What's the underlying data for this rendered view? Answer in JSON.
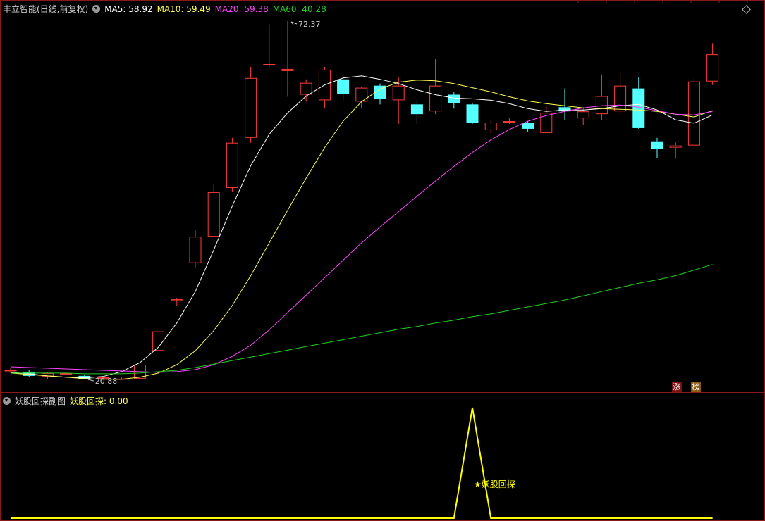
{
  "header": {
    "title": "丰立智能(日线,前复权)",
    "ma5_label": "MA5: 58.92",
    "ma10_label": "MA10: 59.49",
    "ma20_label": "MA20: 59.38",
    "ma60_label": "MA60: 40.28"
  },
  "sub_header": {
    "title": "妖股回探副图",
    "value_label": "妖股回探: 0.00"
  },
  "badges": {
    "zhang": "涨",
    "bang": "榜"
  },
  "colors": {
    "up": "#ff3b3b",
    "down": "#54ffff",
    "ma5": "#ffffff",
    "ma10": "#ffff54",
    "ma20": "#ff44ff",
    "ma60": "#22d022",
    "signal": "#ffff00"
  },
  "chart_data": [
    {
      "type": "candlestick",
      "title": "丰立智能(日线,前复权)",
      "price_range": [
        20.88,
        72.37
      ],
      "annotations": {
        "high": "72.37",
        "low": "20.88"
      },
      "candles": [
        {
          "o": 22.2,
          "c": 22.2,
          "h": 22.6,
          "l": 21.8
        },
        {
          "o": 22.0,
          "c": 21.4,
          "h": 22.2,
          "l": 21.2
        },
        {
          "o": 21.3,
          "c": 21.8,
          "h": 22.0,
          "l": 21.0
        },
        {
          "o": 21.6,
          "c": 21.8,
          "h": 21.9,
          "l": 21.5
        },
        {
          "o": 21.4,
          "c": 20.9,
          "h": 21.6,
          "l": 20.88
        },
        {
          "o": 21.0,
          "c": 21.2,
          "h": 21.3,
          "l": 20.9
        },
        {
          "o": 21.0,
          "c": 21.0,
          "h": 21.2,
          "l": 20.9
        },
        {
          "o": 21.0,
          "c": 23.0,
          "h": 23.2,
          "l": 20.9
        },
        {
          "o": 25.0,
          "c": 27.8,
          "h": 27.8,
          "l": 25.0
        },
        {
          "o": 32.4,
          "c": 32.4,
          "h": 32.6,
          "l": 31.5
        },
        {
          "o": 37.6,
          "c": 41.4,
          "h": 42.3,
          "l": 37.0
        },
        {
          "o": 41.4,
          "c": 47.8,
          "h": 48.8,
          "l": 41.4
        },
        {
          "o": 48.4,
          "c": 54.9,
          "h": 55.6,
          "l": 47.8
        },
        {
          "o": 55.6,
          "c": 64.2,
          "h": 65.8,
          "l": 54.9
        },
        {
          "o": 66.2,
          "c": 66.2,
          "h": 71.8,
          "l": 65.8
        },
        {
          "o": 65.2,
          "c": 65.5,
          "h": 72.37,
          "l": 61.5
        },
        {
          "o": 61.8,
          "c": 63.5,
          "h": 64.0,
          "l": 60.8
        },
        {
          "o": 61.0,
          "c": 65.4,
          "h": 65.8,
          "l": 59.8
        },
        {
          "o": 64.0,
          "c": 61.9,
          "h": 64.5,
          "l": 61.0
        },
        {
          "o": 60.8,
          "c": 62.8,
          "h": 63.0,
          "l": 59.8
        },
        {
          "o": 63.1,
          "c": 61.2,
          "h": 63.4,
          "l": 60.4
        },
        {
          "o": 61.0,
          "c": 63.1,
          "h": 64.3,
          "l": 57.6
        },
        {
          "o": 60.4,
          "c": 59.0,
          "h": 61.0,
          "l": 57.6
        },
        {
          "o": 59.4,
          "c": 63.1,
          "h": 66.9,
          "l": 59.0
        },
        {
          "o": 61.8,
          "c": 60.6,
          "h": 62.2,
          "l": 59.8
        },
        {
          "o": 60.4,
          "c": 57.8,
          "h": 60.6,
          "l": 57.6
        },
        {
          "o": 56.7,
          "c": 57.8,
          "h": 58.0,
          "l": 56.3
        },
        {
          "o": 57.8,
          "c": 58.0,
          "h": 58.4,
          "l": 57.6
        },
        {
          "o": 57.8,
          "c": 56.9,
          "h": 58.0,
          "l": 56.5
        },
        {
          "o": 56.3,
          "c": 59.2,
          "h": 60.2,
          "l": 56.3
        },
        {
          "o": 60.0,
          "c": 59.4,
          "h": 62.7,
          "l": 58.2
        },
        {
          "o": 58.4,
          "c": 59.4,
          "h": 60.0,
          "l": 57.4
        },
        {
          "o": 59.0,
          "c": 61.6,
          "h": 64.7,
          "l": 58.2
        },
        {
          "o": 59.4,
          "c": 63.1,
          "h": 65.1,
          "l": 58.8
        },
        {
          "o": 62.7,
          "c": 57.0,
          "h": 64.3,
          "l": 56.9
        },
        {
          "o": 55.1,
          "c": 54.0,
          "h": 55.6,
          "l": 52.7
        },
        {
          "o": 54.2,
          "c": 54.5,
          "h": 55.0,
          "l": 52.6
        },
        {
          "o": 54.5,
          "c": 63.7,
          "h": 64.1,
          "l": 54.1
        },
        {
          "o": 63.7,
          "c": 67.6,
          "h": 69.2,
          "l": 63.2
        }
      ],
      "series": [
        {
          "name": "MA5",
          "values": [
            21.9,
            21.7,
            21.4,
            21.2,
            21.1,
            21.3,
            22.0,
            23.3,
            25.5,
            29.0,
            33.5,
            39.5,
            45.8,
            51.6,
            56.1,
            59.2,
            61.6,
            63.2,
            64.2,
            64.5,
            64.0,
            63.4,
            62.5,
            61.8,
            61.3,
            61.2,
            61.0,
            60.5,
            59.8,
            59.4,
            59.6,
            59.6,
            59.8,
            60.2,
            60.4,
            59.6,
            58.2,
            57.7,
            58.9
          ]
        },
        {
          "name": "MA10",
          "values": [
            21.8,
            21.6,
            21.4,
            21.2,
            21.0,
            20.9,
            20.9,
            21.2,
            21.8,
            23.0,
            25.0,
            27.9,
            31.5,
            35.8,
            40.5,
            45.2,
            49.8,
            54.2,
            58.0,
            60.8,
            62.6,
            63.6,
            63.9,
            63.8,
            63.4,
            62.8,
            62.2,
            61.5,
            60.9,
            60.5,
            60.2,
            59.9,
            59.8,
            59.7,
            59.6,
            59.4,
            59.0,
            58.6,
            59.5
          ]
        },
        {
          "name": "MA20",
          "values": [
            22.7,
            22.6,
            22.5,
            22.4,
            22.3,
            22.2,
            22.1,
            22.0,
            21.9,
            22.0,
            22.3,
            23.0,
            24.2,
            25.8,
            28.0,
            30.5,
            33.0,
            35.5,
            38.0,
            40.5,
            42.8,
            45.0,
            47.2,
            49.4,
            51.5,
            53.5,
            55.3,
            56.8,
            58.0,
            58.8,
            59.4,
            59.9,
            60.2,
            60.3,
            60.0,
            59.5,
            59.0,
            58.9,
            59.4
          ]
        },
        {
          "name": "MA60",
          "values": [
            21.8,
            21.8,
            21.8,
            21.8,
            21.7,
            21.7,
            21.7,
            21.8,
            22.0,
            22.2,
            22.6,
            23.1,
            23.6,
            24.1,
            24.6,
            25.1,
            25.6,
            26.1,
            26.6,
            27.1,
            27.6,
            28.1,
            28.5,
            29.0,
            29.4,
            29.9,
            30.3,
            30.8,
            31.3,
            31.8,
            32.3,
            32.9,
            33.5,
            34.1,
            34.7,
            35.2,
            35.8,
            36.6,
            37.4
          ]
        }
      ]
    },
    {
      "type": "line",
      "title": "妖股回探副图",
      "series": [
        {
          "name": "妖股回探",
          "values": [
            0,
            0,
            0,
            0,
            0,
            0,
            0,
            0,
            0,
            0,
            0,
            0,
            0,
            0,
            0,
            0,
            0,
            0,
            0,
            0,
            0,
            0,
            0,
            0,
            0,
            1,
            0,
            0,
            0,
            0,
            0,
            0,
            0,
            0,
            0,
            0,
            0,
            0,
            0
          ]
        }
      ],
      "annotation": "★妖股回探"
    }
  ]
}
